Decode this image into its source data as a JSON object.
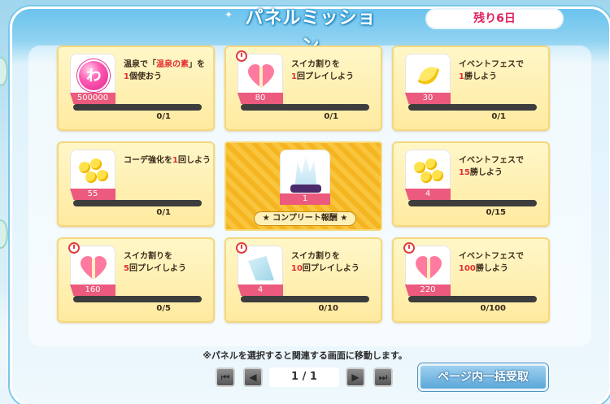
{
  "header": {
    "title": "パネルミッション",
    "days_left": "残り6日"
  },
  "panels": [
    {
      "count": "500000",
      "text_parts": [
        "温泉で「",
        "温泉の素",
        "」を",
        "1",
        "個使おう"
      ],
      "progress": "0/1"
    },
    {
      "count": "80",
      "text_parts": [
        "スイカ割りを",
        "1",
        "回プレイしよう"
      ],
      "progress": "0/1"
    },
    {
      "count": "30",
      "text_parts": [
        "イベントフェスで",
        "1",
        "勝しよう"
      ],
      "progress": "0/1"
    },
    {
      "count": "55",
      "text_parts": [
        "コーデ強化を",
        "1",
        "回しよう"
      ],
      "progress": "0/1"
    },
    {
      "count": "4",
      "text_parts": [
        "イベントフェスで",
        "15",
        "勝しよう"
      ],
      "progress": "0/15"
    },
    {
      "count": "160",
      "text_parts": [
        "スイカ割りを",
        "5",
        "回プレイしよう"
      ],
      "progress": "0/5"
    },
    {
      "count": "4",
      "text_parts": [
        "スイカ割りを",
        "10",
        "回プレイしよう"
      ],
      "progress": "0/10"
    },
    {
      "count": "220",
      "text_parts": [
        "イベントフェスで",
        "100",
        "勝しよう"
      ],
      "progress": "0/100"
    }
  ],
  "complete_reward": {
    "count": "1",
    "label": "★ コンプリート報酬 ★"
  },
  "footnote": "※パネルを選択すると関連する画面に移動します。",
  "pager": {
    "page": "1  /  1"
  },
  "collect_button": "ページ内一括受取"
}
